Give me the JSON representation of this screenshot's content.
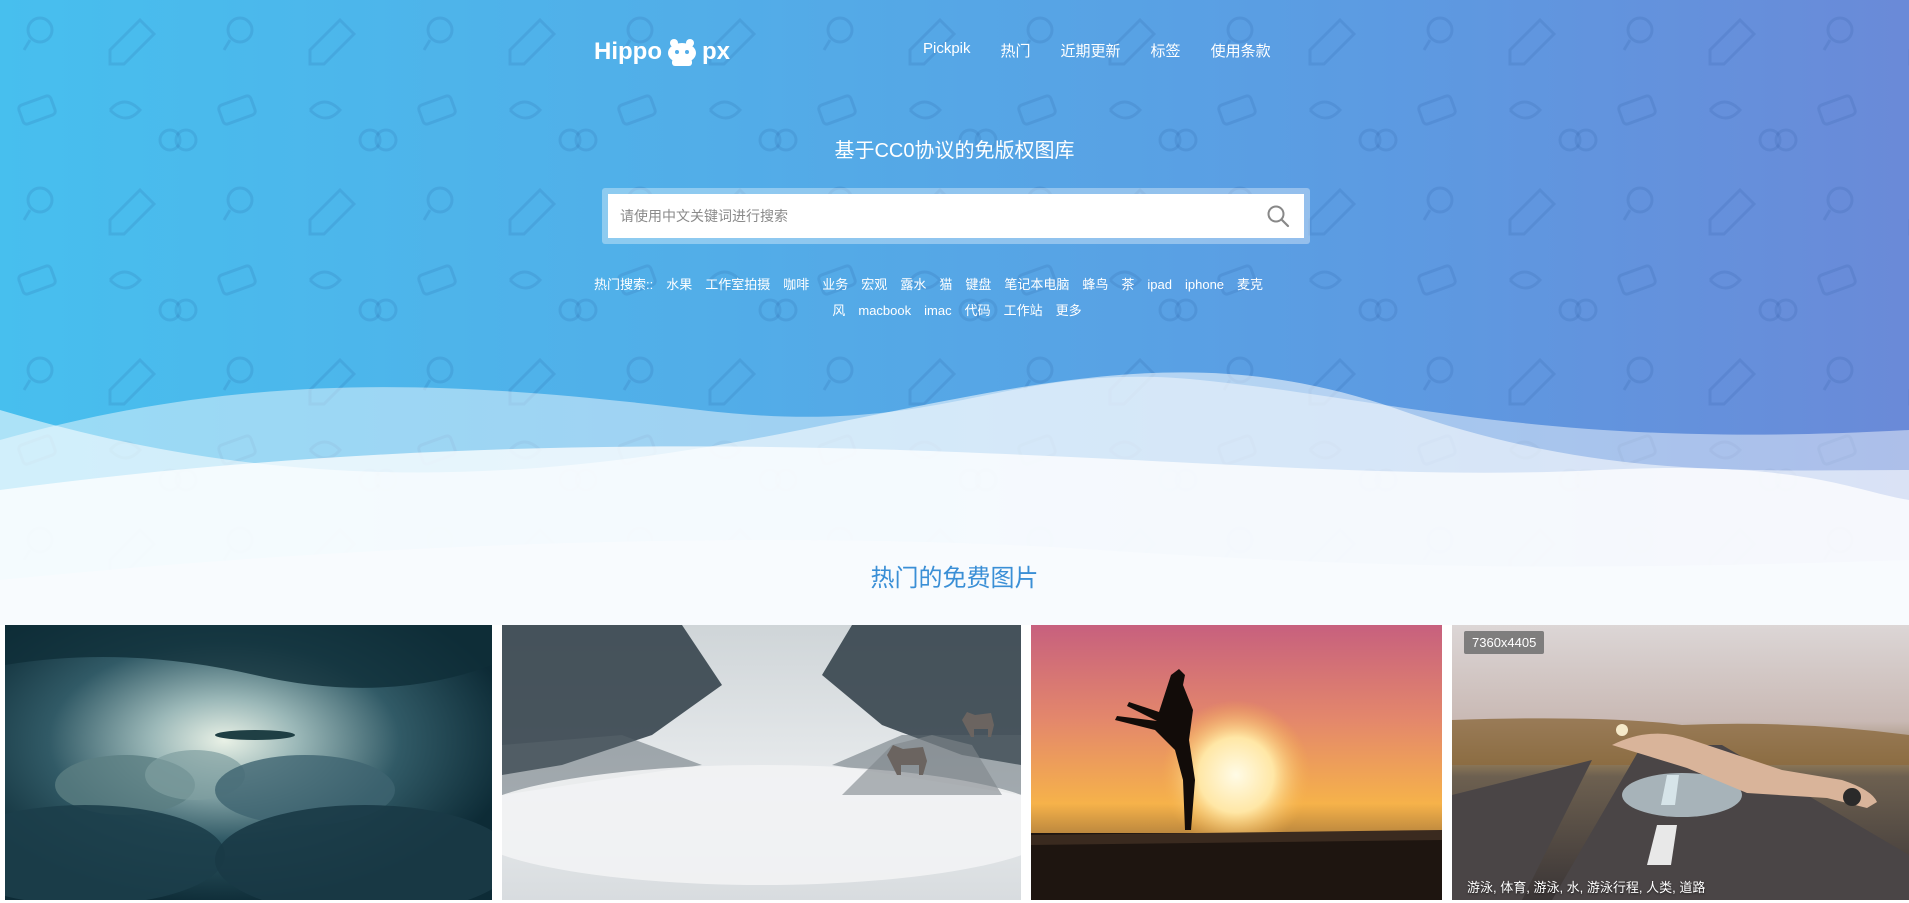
{
  "header": {
    "logo_left": "Hippo",
    "logo_right": "px",
    "nav": [
      "Pickpik",
      "热门",
      "近期更新",
      "标签",
      "使用条款"
    ]
  },
  "hero": {
    "tagline": "基于CC0协议的免版权图库",
    "search_placeholder": "请使用中文关键词进行搜索",
    "hot_label": "热门搜索::",
    "hot_tags_line1": [
      "水果",
      "工作室拍摄",
      "咖啡",
      "业务",
      "宏观",
      "露水",
      "猫",
      "键盘",
      "笔记本电脑",
      "蜂鸟",
      "茶",
      "ipad",
      "iphone",
      "麦克"
    ],
    "hot_tags_line2": [
      "风",
      "macbook",
      "imac",
      "代码",
      "工作站",
      "更多"
    ]
  },
  "section": {
    "title": "热门的免费图片"
  },
  "photos": [
    {
      "subject": "clouds"
    },
    {
      "subject": "wolves-in-fog"
    },
    {
      "subject": "sunset-silhouette"
    },
    {
      "subject": "swimmer-on-road",
      "dimensions": "7360x4405",
      "tags": "游泳, 体育, 游泳, 水, 游泳行程, 人类, 道路"
    }
  ],
  "colors": {
    "hero_start": "#47bfee",
    "hero_end": "#6a8ad8",
    "section_title": "#3a8fd6"
  }
}
